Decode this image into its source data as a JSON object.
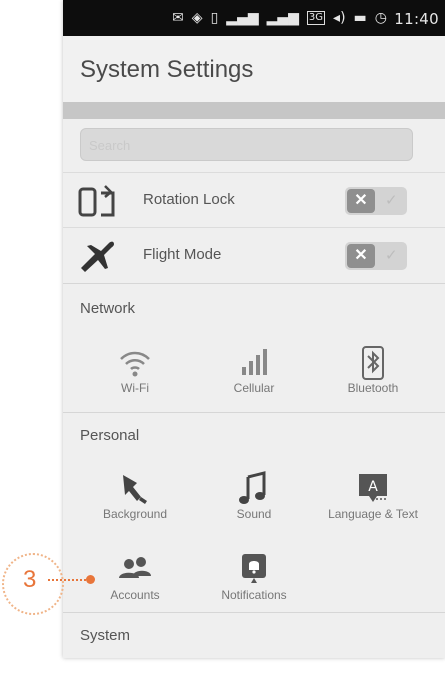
{
  "status_bar": {
    "time": "11:40",
    "icons": [
      "mail-icon",
      "location-icon",
      "sim-icon",
      "signal-icon",
      "signal-icon",
      "3g-icon",
      "volume-icon",
      "battery-icon",
      "alarm-icon"
    ]
  },
  "header": {
    "title": "System Settings"
  },
  "search": {
    "placeholder": "Search"
  },
  "toggles": [
    {
      "label": "Rotation Lock",
      "icon": "rotation-lock-icon",
      "off_glyph": "✕",
      "on_glyph": "✓"
    },
    {
      "label": "Flight Mode",
      "icon": "airplane-icon",
      "off_glyph": "✕",
      "on_glyph": "✓"
    }
  ],
  "sections": {
    "network": {
      "title": "Network",
      "items": [
        {
          "label": "Wi-Fi",
          "icon": "wifi-icon"
        },
        {
          "label": "Cellular",
          "icon": "cellular-icon"
        },
        {
          "label": "Bluetooth",
          "icon": "bluetooth-icon"
        }
      ]
    },
    "personal": {
      "title": "Personal",
      "items": [
        {
          "label": "Background",
          "icon": "background-icon"
        },
        {
          "label": "Sound",
          "icon": "music-note-icon"
        },
        {
          "label": "Language & Text",
          "icon": "language-icon"
        },
        {
          "label": "Accounts",
          "icon": "accounts-icon"
        },
        {
          "label": "Notifications",
          "icon": "notifications-icon"
        }
      ]
    },
    "system": {
      "title": "System"
    }
  },
  "callout": {
    "number": "3"
  },
  "colors": {
    "accent": "#e8753a",
    "statusbar": "#0d0d0d",
    "background": "#efefef"
  }
}
